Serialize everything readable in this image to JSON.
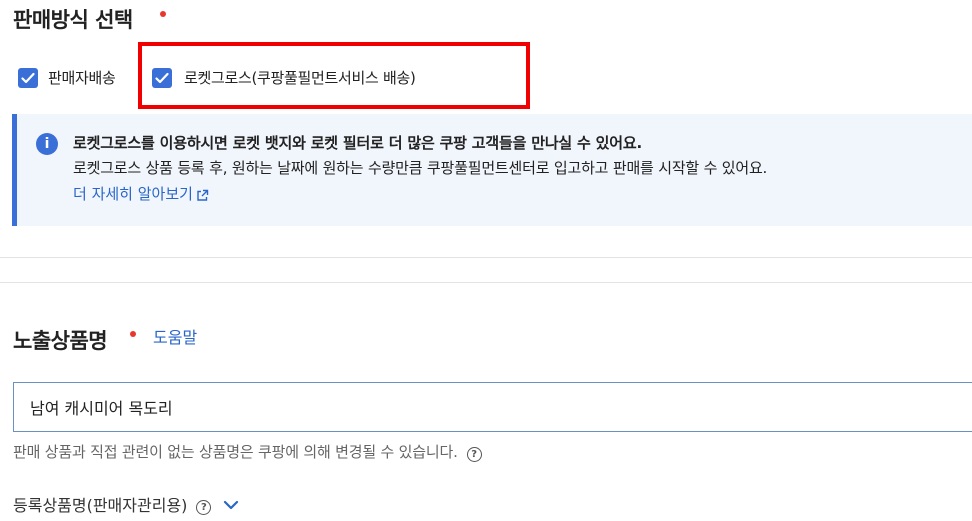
{
  "sales_method": {
    "title": "판매방식 선택",
    "options": [
      {
        "label": "판매자배송",
        "checked": true
      },
      {
        "label": "로켓그로스(쿠팡풀필먼트서비스 배송)",
        "checked": true
      }
    ],
    "highlight_color": "#f00000"
  },
  "info": {
    "icon": "info-icon",
    "headline": "로켓그로스를 이용하시면 로켓 뱃지와 로켓 필터로 더 많은 쿠팡 고객들을 만나실 수 있어요.",
    "body": "로켓그로스 상품 등록 후, 원하는 날짜에 원하는 수량만큼 쿠팡풀필먼트센터로 입고하고 판매를 시작할 수 있어요.",
    "link_label": "더 자세히 알아보기"
  },
  "product_name": {
    "title": "노출상품명",
    "help_link": "도움말",
    "value": "남여 캐시미어 목도리",
    "hint": "판매 상품과 직접 관련이 없는 상품명은 쿠팡에 의해 변경될 수 있습니다.",
    "help_icon": "question-icon"
  },
  "registered_name": {
    "label": "등록상품명(판매자관리용)",
    "help_icon": "question-icon",
    "toggle_icon": "chevron-down-icon"
  },
  "colors": {
    "accent": "#3a6fd8",
    "required": "#e8382d",
    "link": "#2a66c9"
  }
}
